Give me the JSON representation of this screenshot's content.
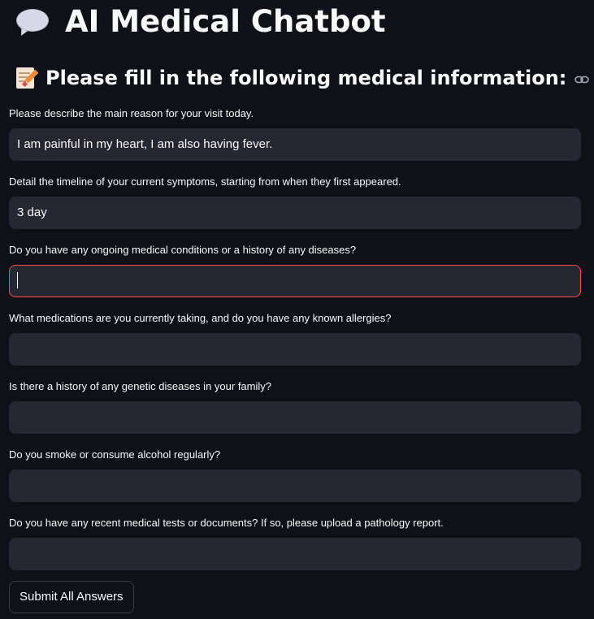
{
  "header": {
    "title": "AI Medical Chatbot",
    "title_icon": "speech-bubble-icon"
  },
  "section": {
    "subheader": "Please fill in the following medical information:",
    "subheader_icon": "memo-icon",
    "anchor_icon": "link-icon"
  },
  "form": {
    "fields": [
      {
        "label": "Please describe the main reason for your visit today.",
        "value": "I am painful in my heart, I am also having fever."
      },
      {
        "label": "Detail the timeline of your current symptoms, starting from when they first appeared.",
        "value": "3 day"
      },
      {
        "label": "Do you have any ongoing medical conditions or a history of any diseases?",
        "value": ""
      },
      {
        "label": "What medications are you currently taking, and do you have any known allergies?",
        "value": ""
      },
      {
        "label": "Is there a history of any genetic diseases in your family?",
        "value": ""
      },
      {
        "label": "Do you smoke or consume alcohol regularly?",
        "value": ""
      },
      {
        "label": "Do you have any recent medical tests or documents? If so, please upload a pathology report.",
        "value": ""
      }
    ],
    "submit_label": "Submit All Answers"
  },
  "colors": {
    "background": "#0e1117",
    "input_background": "#262730",
    "focus_border": "#ff4b4b",
    "text": "#fafafa"
  }
}
